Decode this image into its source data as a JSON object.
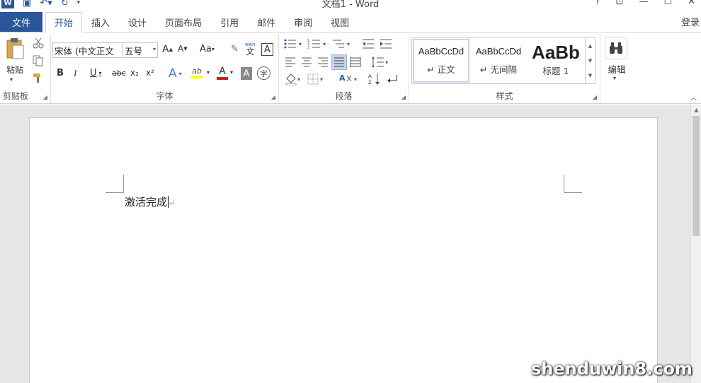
{
  "title_bar": {
    "app_logo": "W",
    "document_title": "文档1 - Word",
    "help": "?",
    "restore_ribbon": "⊡",
    "minimize": "—",
    "maximize": "☐",
    "close": "✕"
  },
  "tabs": {
    "file": "文件",
    "items": [
      "开始",
      "插入",
      "设计",
      "页面布局",
      "引用",
      "邮件",
      "审阅",
      "视图"
    ],
    "login": "登录"
  },
  "clipboard": {
    "paste": "粘贴",
    "label": "剪贴板"
  },
  "font": {
    "font_name": "宋体 (中文正文",
    "font_size": "五号",
    "grow": "A",
    "shrink": "A",
    "change_case": "Aa",
    "phonetic": "wén",
    "phonetic_char": "文",
    "border_char": "A",
    "bold": "B",
    "italic": "I",
    "underline": "U",
    "strikethrough": "abc",
    "subscript": "x₂",
    "superscript": "x²",
    "text_effect": "A",
    "highlight": "ab",
    "font_color": "A",
    "char_shading": "A",
    "enclose_char": "字",
    "label": "字体"
  },
  "paragraph": {
    "label": "段落"
  },
  "styles": {
    "items": [
      {
        "sample": "AaBbCcDd",
        "name": "↵ 正文"
      },
      {
        "sample": "AaBbCcDd",
        "name": "↵ 无间隔"
      },
      {
        "sample": "AaBb",
        "name": "标题 1"
      }
    ],
    "label": "样式"
  },
  "editing": {
    "label": "编辑"
  },
  "document": {
    "text": "激活完成",
    "paragraph_mark": "↵"
  },
  "watermark": "shenduwin8.com",
  "colors": {
    "word_blue": "#2b579a",
    "highlight_yellow": "#ffff00",
    "font_red": "#e81123"
  }
}
